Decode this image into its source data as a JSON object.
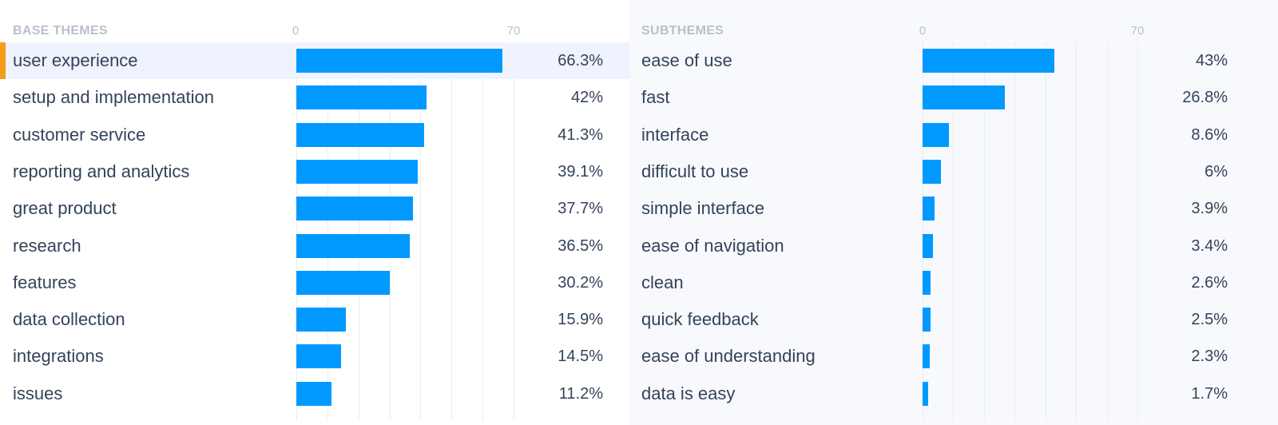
{
  "chart_data": [
    {
      "type": "bar",
      "orientation": "horizontal",
      "title": "BASE THEMES",
      "xlim": [
        0,
        70
      ],
      "ticks": [
        "0",
        "70"
      ],
      "grid": true,
      "grid_step": 10,
      "categories": [
        "user experience",
        "setup and implementation",
        "customer service",
        "reporting and analytics",
        "great product",
        "research",
        "features",
        "data collection",
        "integrations",
        "issues"
      ],
      "values": [
        66.3,
        42,
        41.3,
        39.1,
        37.7,
        36.5,
        30.2,
        15.9,
        14.5,
        11.2
      ],
      "value_labels": [
        "66.3%",
        "42%",
        "41.3%",
        "39.1%",
        "37.7%",
        "36.5%",
        "30.2%",
        "15.9%",
        "14.5%",
        "11.2%"
      ],
      "selected_index": 0,
      "bar_color": "#0099ff",
      "selected_marker_color": "#f59b1c"
    },
    {
      "type": "bar",
      "orientation": "horizontal",
      "title": "SUBTHEMES",
      "xlim": [
        0,
        70
      ],
      "ticks": [
        "0",
        "70"
      ],
      "grid": true,
      "grid_step": 10,
      "categories": [
        "ease of use",
        "fast",
        "interface",
        "difficult to use",
        "simple interface",
        "ease of navigation",
        "clean",
        "quick feedback",
        "ease of understanding",
        "data is easy"
      ],
      "values": [
        43,
        26.8,
        8.6,
        6,
        3.9,
        3.4,
        2.6,
        2.5,
        2.3,
        1.7
      ],
      "value_labels": [
        "43%",
        "26.8%",
        "8.6%",
        "6%",
        "3.9%",
        "3.4%",
        "2.6%",
        "2.5%",
        "2.3%",
        "1.7%"
      ],
      "bar_color": "#0099ff"
    }
  ]
}
